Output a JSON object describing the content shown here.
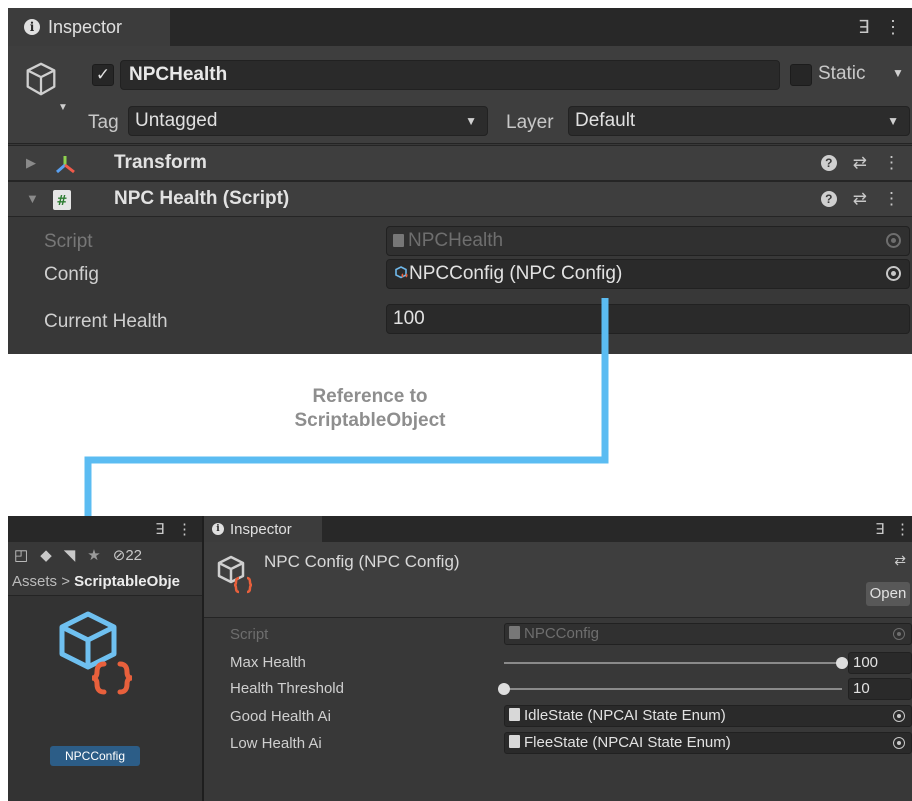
{
  "top_inspector": {
    "tab_label": "Inspector",
    "lock_glyph": "ꓱ",
    "menu_glyph": "⋮",
    "gameobject": {
      "active_check": "✓",
      "name": "NPCHealth",
      "static_label": "Static",
      "tag_label": "Tag",
      "tag_value": "Untagged",
      "layer_label": "Layer",
      "layer_value": "Default"
    },
    "components": [
      {
        "title": "Transform",
        "icon": "transform-axes-icon"
      },
      {
        "title": "NPC Health (Script)",
        "icon": "csharp-script-icon"
      }
    ],
    "properties": {
      "script_label": "Script",
      "script_value": "NPCHealth",
      "config_label": "Config",
      "config_value": "NPCConfig (NPC Config)",
      "health_label": "Current Health",
      "health_value": "100"
    }
  },
  "annotation": {
    "line1": "Reference to",
    "line2": "ScriptableObject",
    "arrow_color": "#5bbcf2"
  },
  "project_panel": {
    "hidden_count": "22",
    "breadcrumb_root": "Assets",
    "breadcrumb_separator": ">",
    "breadcrumb_folder": "ScriptableObje",
    "asset_name": "NPCConfig"
  },
  "bottom_inspector": {
    "tab_label": "Inspector",
    "title": "NPC Config (NPC Config)",
    "open_button": "Open",
    "script_label": "Script",
    "script_value": "NPCConfig",
    "max_health_label": "Max Health",
    "max_health_value": "100",
    "threshold_label": "Health Threshold",
    "threshold_value": "10",
    "good_ai_label": "Good Health Ai",
    "good_ai_value": "IdleState (NPCAI State Enum)",
    "low_ai_label": "Low Health Ai",
    "low_ai_value": "FleeState (NPCAI State Enum)"
  },
  "colors": {
    "accent_blue": "#5bbcf2",
    "brace_orange": "#e8603c",
    "selection_blue": "#2c5d87"
  }
}
